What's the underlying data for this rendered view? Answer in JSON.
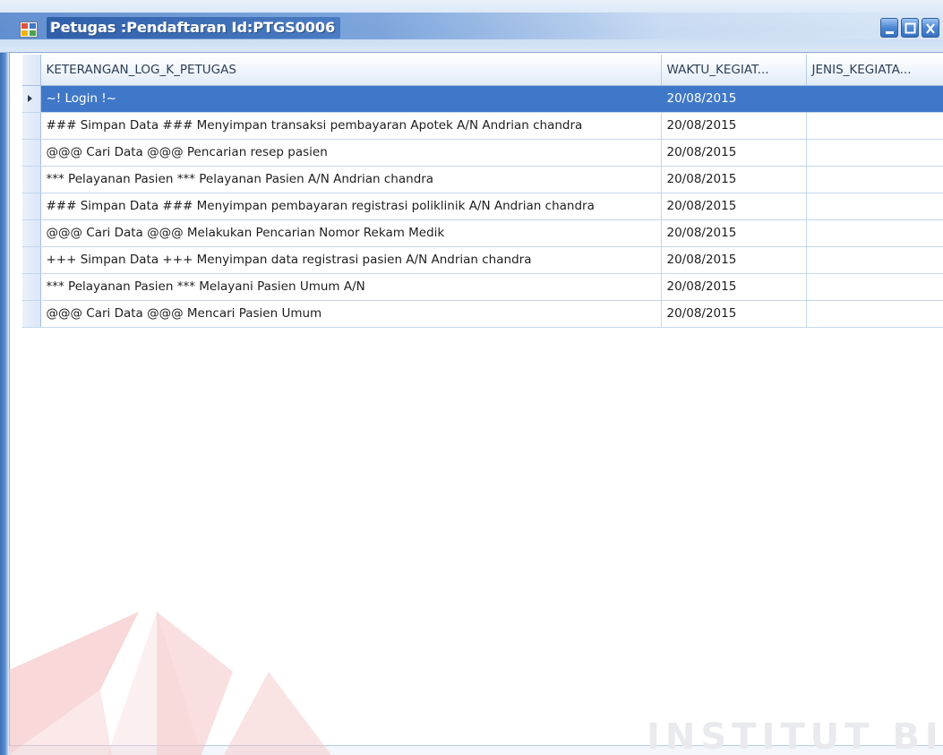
{
  "window": {
    "title": "Petugas :Pendaftaran Id:PTGS0006",
    "controls": [
      "minimize-icon",
      "maximize-icon",
      "close-icon"
    ]
  },
  "grid": {
    "columns": [
      "KETERANGAN_LOG_K_PETUGAS",
      "WAKTU_KEGIAT...",
      "JENIS_KEGIATA..."
    ],
    "rows": [
      [
        "~! Login !~",
        "20/08/2015",
        ""
      ],
      [
        "### Simpan Data ### Menyimpan transaksi pembayaran Apotek A/N  Andrian chandra",
        "20/08/2015",
        ""
      ],
      [
        "@@@ Cari Data @@@ Pencarian resep pasien",
        "20/08/2015",
        ""
      ],
      [
        "*** Pelayanan Pasien *** Pelayanan Pasien A/N Andrian chandra",
        "20/08/2015",
        ""
      ],
      [
        "### Simpan Data ### Menyimpan pembayaran registrasi poliklinik A/N Andrian chandra",
        "20/08/2015",
        ""
      ],
      [
        "@@@ Cari Data @@@ Melakukan Pencarian Nomor Rekam Medik",
        "20/08/2015",
        ""
      ],
      [
        "+++ Simpan Data +++ Menyimpan data registrasi pasien A/N Andrian chandra",
        "20/08/2015",
        ""
      ],
      [
        "*** Pelayanan Pasien *** Melayani Pasien Umum A/N",
        "20/08/2015",
        ""
      ],
      [
        "@@@ Cari Data @@@ Mencari Pasien Umum",
        "20/08/2015",
        ""
      ]
    ],
    "selected_row": 0
  },
  "watermark": {
    "text": "INSTITUT BISNIS"
  },
  "colors": {
    "selection": "#3f78c8",
    "title_bar": "#4a7cc3",
    "grid_line": "#c5d6ec"
  }
}
